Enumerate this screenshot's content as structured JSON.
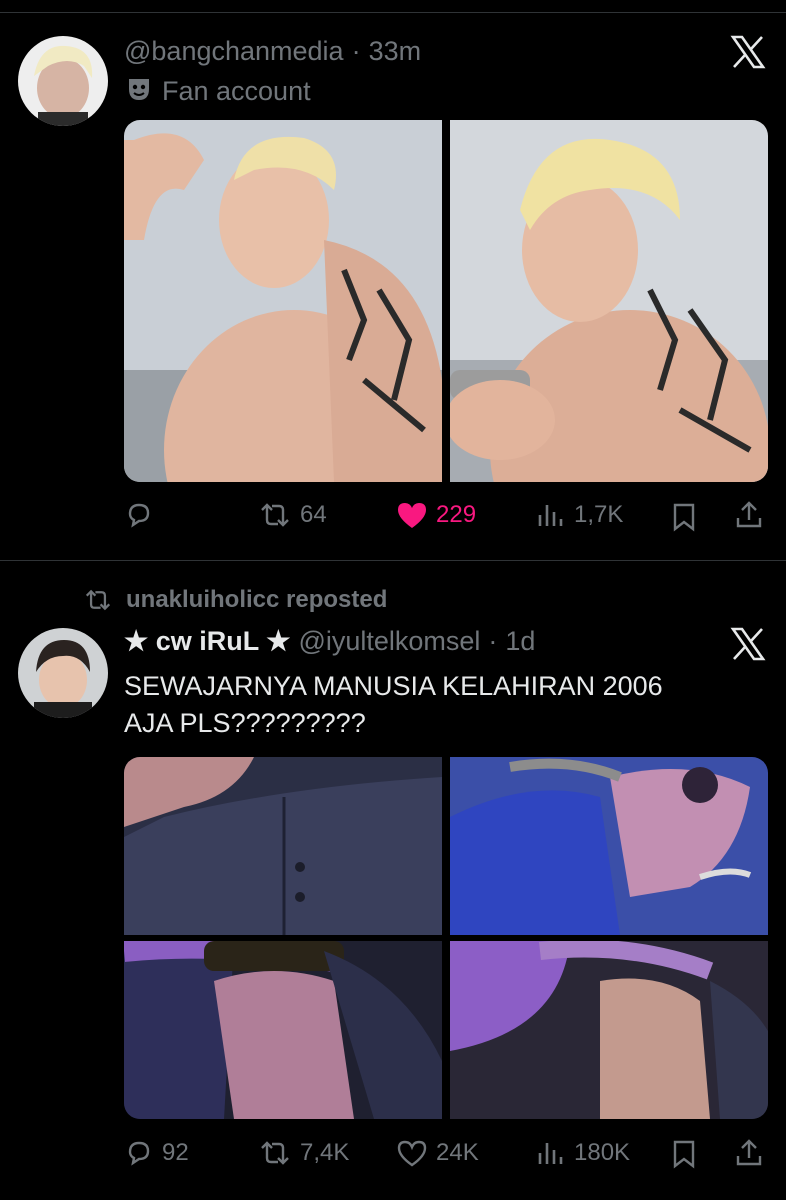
{
  "post1": {
    "handle": "@bangchanmedia",
    "separator": "·",
    "time": "33m",
    "label_icon": "mask-icon",
    "label": "Fan account",
    "actions": {
      "replies": "",
      "reposts": "64",
      "likes": "229",
      "views": "1,7K"
    },
    "liked": true,
    "accent": "#f91880"
  },
  "post2": {
    "repost_label": "unakluiholicc reposted",
    "display_name": "★ cw iRuL ★",
    "handle": "@iyultelkomsel",
    "separator": "·",
    "time": "1d",
    "text_line1": "SEWAJARNYA MANUSIA KELAHIRAN 2006",
    "text_line2": "AJA PLS?????????",
    "actions": {
      "replies": "92",
      "reposts": "7,4K",
      "likes": "24K",
      "views": "180K"
    }
  },
  "colors": {
    "background": "#000000",
    "muted": "#71767b",
    "text": "#e7e9ea",
    "like": "#f91880"
  }
}
